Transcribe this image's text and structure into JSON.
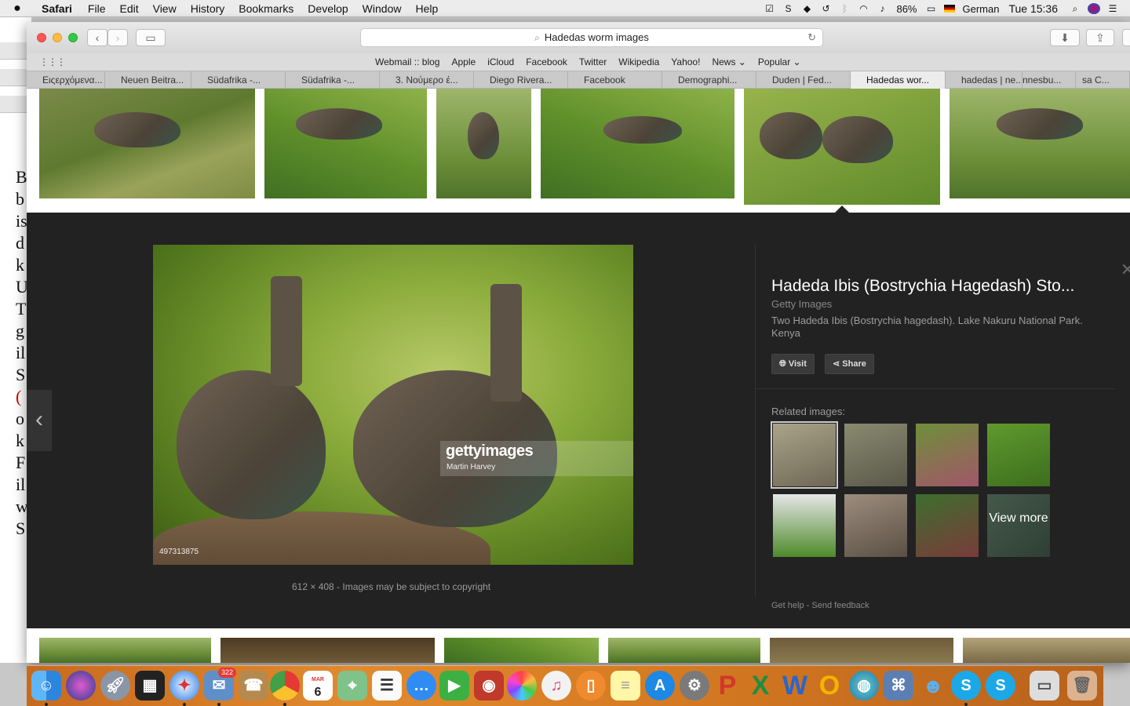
{
  "menubar": {
    "apple": "",
    "app_name": "Safari",
    "items": [
      "File",
      "Edit",
      "View",
      "History",
      "Bookmarks",
      "Develop",
      "Window",
      "Help"
    ],
    "battery": "86%",
    "input_lang": "German",
    "clock": "Tue 15:36"
  },
  "safari": {
    "url_text": "Hadedas worm images",
    "favorites": [
      "Webmail :: blog",
      "Apple",
      "iCloud",
      "Facebook",
      "Twitter",
      "Wikipedia",
      "Yahoo!",
      "News ⌄",
      "Popular ⌄"
    ],
    "tabs": [
      {
        "label": "Ειςερχόμενα...",
        "active": false
      },
      {
        "label": "Neuen Beitra...",
        "active": false
      },
      {
        "label": "Südafrika -...",
        "active": false
      },
      {
        "label": "Südafrika -...",
        "active": false
      },
      {
        "label": "3. Νούμερο έ...",
        "active": false
      },
      {
        "label": "Diego Rivera...",
        "active": false
      },
      {
        "label": "Facebook",
        "active": false
      },
      {
        "label": "Demographi...",
        "active": false
      },
      {
        "label": "Duden | Fed...",
        "active": false
      },
      {
        "label": "Hadedas wor...",
        "active": true
      },
      {
        "label": "hadedas | ne...",
        "active": false
      },
      {
        "label": "nnesbu...",
        "active": false
      },
      {
        "label": "sa C...",
        "active": false
      }
    ]
  },
  "detail": {
    "image_id": "497313875",
    "watermark_brand": "gettyimages",
    "watermark_author": "Martin Harvey",
    "image_meta": "612 × 408  -  Images may be subject to copyright",
    "title": "Hadeda Ibis (Bostrychia Hagedash) Sto...",
    "source": "Getty Images",
    "description": "Two Hadeda Ibis (Bostrychia hagedash). Lake Nakuru National Park. Kenya",
    "visit_label": "Visit",
    "share_label": "Share",
    "related_label": "Related images:",
    "view_more_label": "View more",
    "help_label": "Get help",
    "feedback_label": "Send feedback"
  },
  "dock": {
    "badge_mail": "322",
    "calendar_month": "MAR",
    "calendar_day": "6"
  },
  "colors": {
    "detail_bg": "#222222",
    "dock_accent": "#e08a2e"
  }
}
